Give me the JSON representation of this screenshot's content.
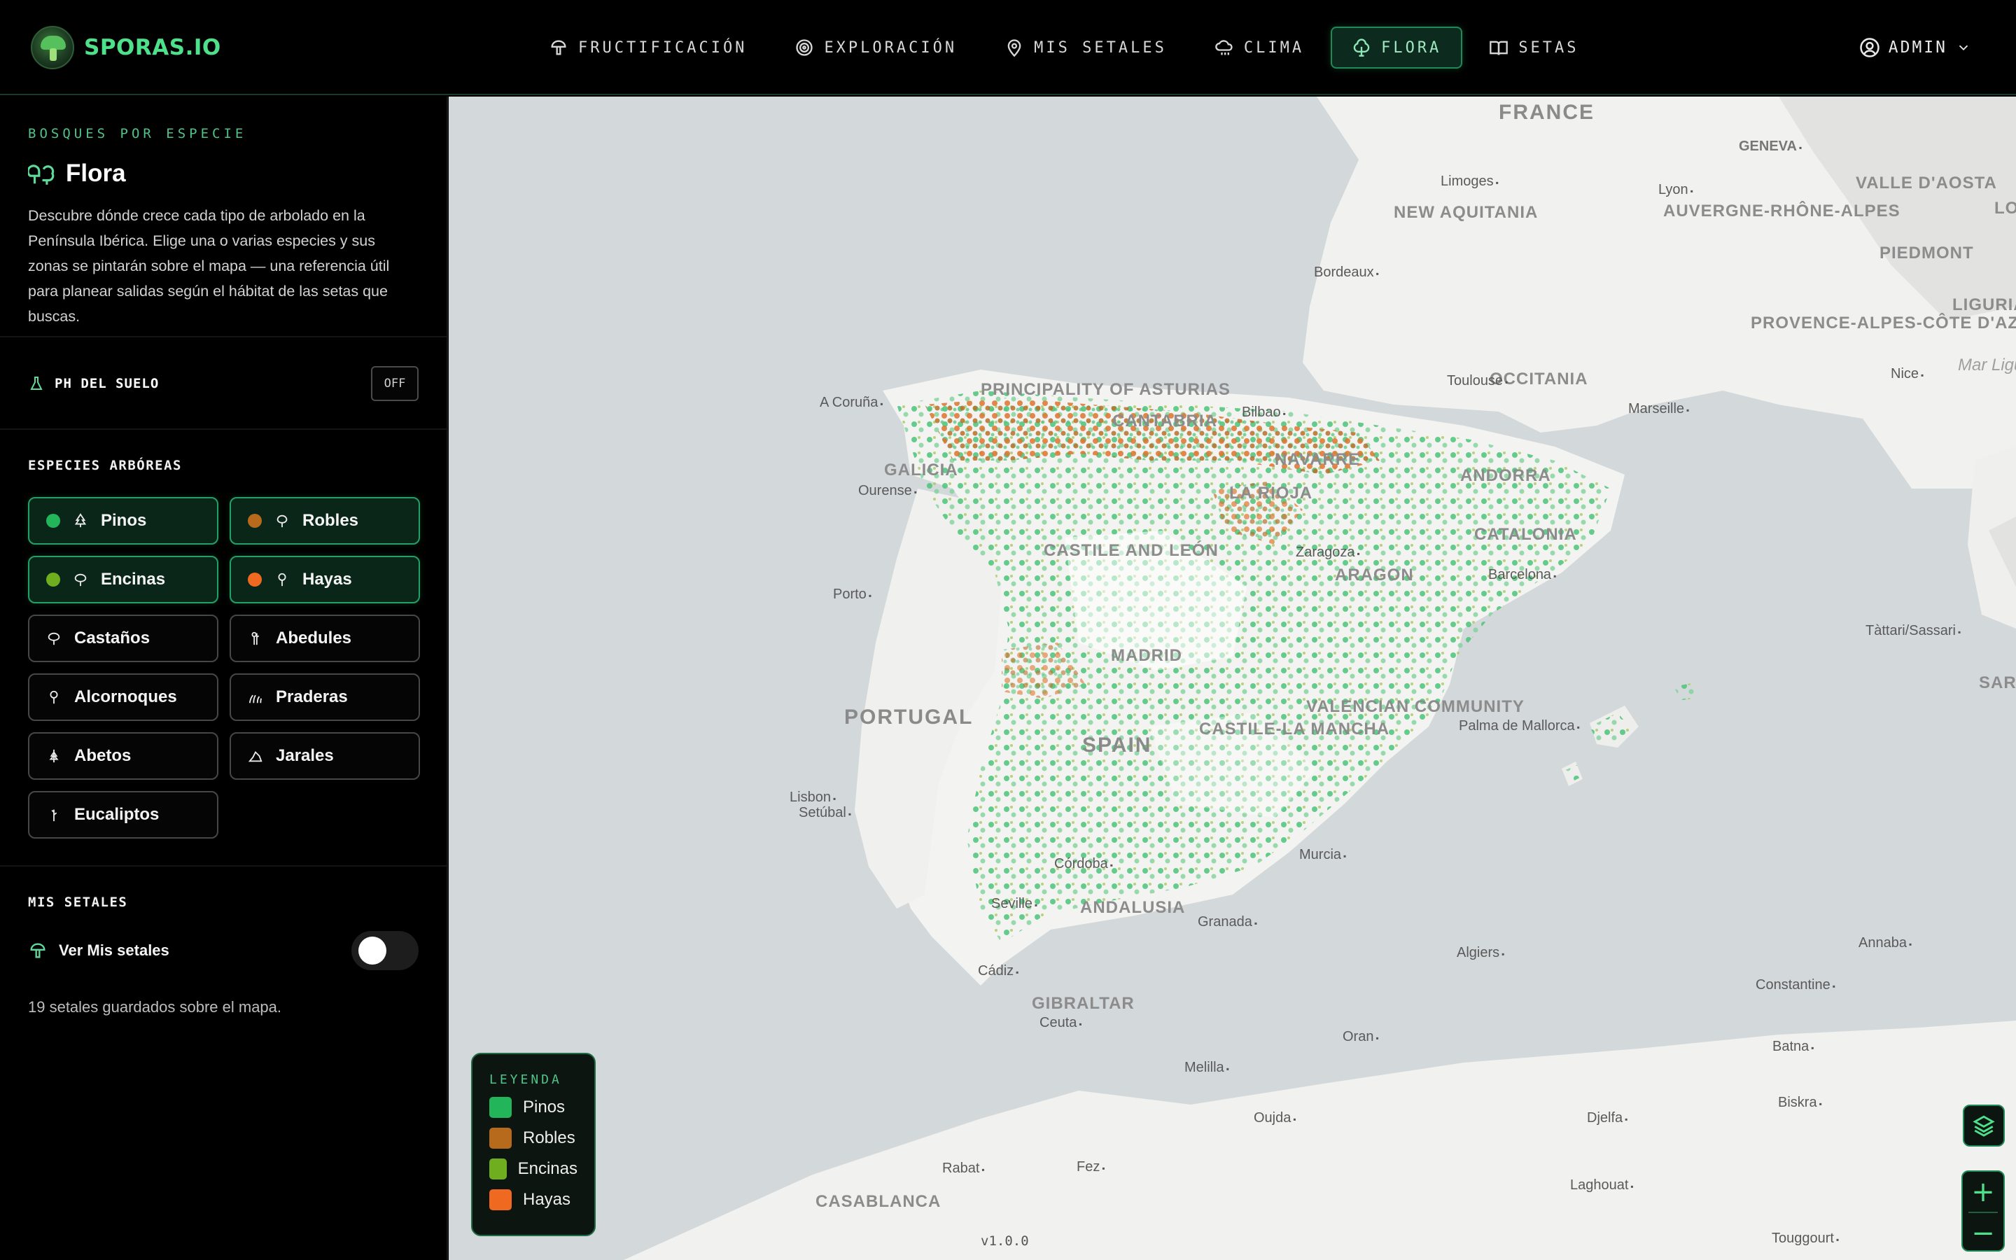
{
  "brand": {
    "name": "SPORAS.IO"
  },
  "nav": {
    "items": [
      {
        "label": "FRUCTIFICACIÓN",
        "icon": "mushroom-icon",
        "active": false
      },
      {
        "label": "EXPLORACIÓN",
        "icon": "target-icon",
        "active": false
      },
      {
        "label": "MIS SETALES",
        "icon": "map-pin-icon",
        "active": false
      },
      {
        "label": "CLIMA",
        "icon": "cloud-rain-icon",
        "active": false
      },
      {
        "label": "FLORA",
        "icon": "tree-icon",
        "active": true
      },
      {
        "label": "SETAS",
        "icon": "book-icon",
        "active": false
      }
    ]
  },
  "user": {
    "label": "ADMIN",
    "icon": "user-circle-icon"
  },
  "sidebar": {
    "eyebrow": "BOSQUES POR ESPECIE",
    "title": "Flora",
    "description": "Descubre dónde crece cada tipo de arbolado en la Península Ibérica. Elige una o varias especies y sus zonas se pintarán sobre el mapa — una referencia útil para planear salidas según el hábitat de las setas que buscas.",
    "ph": {
      "label": "PH DEL SUELO",
      "toggle_label": "OFF"
    },
    "species_label": "ESPECIES ARBÓREAS",
    "species": [
      {
        "label": "Pinos",
        "selected": true,
        "color": "#22b55a"
      },
      {
        "label": "Robles",
        "selected": true,
        "color": "#b86a1c"
      },
      {
        "label": "Encinas",
        "selected": true,
        "color": "#6fae1e"
      },
      {
        "label": "Hayas",
        "selected": true,
        "color": "#ef6a20"
      },
      {
        "label": "Castaños",
        "selected": false
      },
      {
        "label": "Abedules",
        "selected": false
      },
      {
        "label": "Alcornoques",
        "selected": false
      },
      {
        "label": "Praderas",
        "selected": false
      },
      {
        "label": "Abetos",
        "selected": false
      },
      {
        "label": "Jarales",
        "selected": false
      },
      {
        "label": "Eucaliptos",
        "selected": false
      }
    ],
    "setales": {
      "section_label": "MIS SETALES",
      "toggle_label": "Ver Mis setales",
      "toggle_on": false,
      "note": "19 setales guardados sobre el mapa."
    }
  },
  "map": {
    "countries": [
      "FRANCE",
      "PORTUGAL",
      "SPAIN"
    ],
    "regions": [
      "NEW AQUITANIA",
      "AUVERGNE-RHÔNE-ALPES",
      "OCCITANIA",
      "PROVENCE-ALPES-CÔTE D'AZUR",
      "PIEDMONT",
      "LIGURIA",
      "VALLE D'AOSTA",
      "PRINCIPALITY OF ASTURIAS",
      "CANTABRIA",
      "GALICIA",
      "NAVARRE",
      "LA RIOJA",
      "CASTILE AND LEÓN",
      "ARAGON",
      "CATALONIA",
      "ANDORRA",
      "MADRID",
      "CASTILE-LA MANCHA",
      "VALENCIAN COMMUNITY",
      "ANDALUSIA",
      "GIBRALTAR",
      "CASABLANCA",
      "SARDIN",
      "LO"
    ],
    "cities": [
      "Limoges",
      "Lyon",
      "GENEVA",
      "Bordeaux",
      "Toulouse",
      "Marseille",
      "Nice",
      "A Coruña",
      "Bilbao",
      "Ourense",
      "Zaragoza",
      "Barcelona",
      "Porto",
      "Tàttari/Sassari",
      "Palma de Mallorca",
      "Lisbon",
      "Setúbal",
      "Córdoba",
      "Murcia",
      "Seville",
      "Granada",
      "Cádiz",
      "Ceuta",
      "Algiers",
      "Annaba",
      "Constantine",
      "Oran",
      "Melilla",
      "Batna",
      "Biskra",
      "Oujda",
      "Djelfa",
      "Rabat",
      "Fez",
      "Laghouat",
      "Touggourt"
    ],
    "sea_label": "Mar Ligure Mer Ligure",
    "legend": {
      "title": "LEYENDA",
      "items": [
        {
          "label": "Pinos",
          "color": "#22b55a"
        },
        {
          "label": "Robles",
          "color": "#b86a1c"
        },
        {
          "label": "Encinas",
          "color": "#6fae1e"
        },
        {
          "label": "Hayas",
          "color": "#ef6a20"
        }
      ]
    },
    "version": "v1.0.0",
    "controls": {
      "layers_icon": "layers-icon",
      "zoom_in": "+",
      "zoom_out": "−"
    }
  }
}
